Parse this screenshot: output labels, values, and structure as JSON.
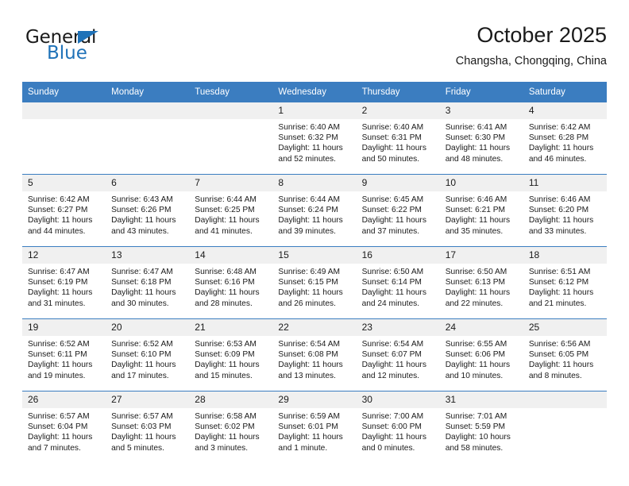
{
  "brand": {
    "name_top": "General",
    "name_bottom": "Blue",
    "accent_color": "#1f72b8",
    "triangle_icon": "triangle-icon"
  },
  "header": {
    "title": "October 2025",
    "subtitle": "Changsha, Chongqing, China"
  },
  "calendar": {
    "header_bg": "#3b7dc0",
    "daynum_bg": "#f0f0f0",
    "weekday_headers": [
      "Sunday",
      "Monday",
      "Tuesday",
      "Wednesday",
      "Thursday",
      "Friday",
      "Saturday"
    ],
    "labels": {
      "sunrise": "Sunrise:",
      "sunset": "Sunset:",
      "daylight": "Daylight:"
    },
    "weeks": [
      [
        {
          "day": "",
          "empty": true
        },
        {
          "day": "",
          "empty": true
        },
        {
          "day": "",
          "empty": true
        },
        {
          "day": "1",
          "sunrise": "Sunrise: 6:40 AM",
          "sunset": "Sunset: 6:32 PM",
          "daylight": "Daylight: 11 hours and 52 minutes."
        },
        {
          "day": "2",
          "sunrise": "Sunrise: 6:40 AM",
          "sunset": "Sunset: 6:31 PM",
          "daylight": "Daylight: 11 hours and 50 minutes."
        },
        {
          "day": "3",
          "sunrise": "Sunrise: 6:41 AM",
          "sunset": "Sunset: 6:30 PM",
          "daylight": "Daylight: 11 hours and 48 minutes."
        },
        {
          "day": "4",
          "sunrise": "Sunrise: 6:42 AM",
          "sunset": "Sunset: 6:28 PM",
          "daylight": "Daylight: 11 hours and 46 minutes."
        }
      ],
      [
        {
          "day": "5",
          "sunrise": "Sunrise: 6:42 AM",
          "sunset": "Sunset: 6:27 PM",
          "daylight": "Daylight: 11 hours and 44 minutes."
        },
        {
          "day": "6",
          "sunrise": "Sunrise: 6:43 AM",
          "sunset": "Sunset: 6:26 PM",
          "daylight": "Daylight: 11 hours and 43 minutes."
        },
        {
          "day": "7",
          "sunrise": "Sunrise: 6:44 AM",
          "sunset": "Sunset: 6:25 PM",
          "daylight": "Daylight: 11 hours and 41 minutes."
        },
        {
          "day": "8",
          "sunrise": "Sunrise: 6:44 AM",
          "sunset": "Sunset: 6:24 PM",
          "daylight": "Daylight: 11 hours and 39 minutes."
        },
        {
          "day": "9",
          "sunrise": "Sunrise: 6:45 AM",
          "sunset": "Sunset: 6:22 PM",
          "daylight": "Daylight: 11 hours and 37 minutes."
        },
        {
          "day": "10",
          "sunrise": "Sunrise: 6:46 AM",
          "sunset": "Sunset: 6:21 PM",
          "daylight": "Daylight: 11 hours and 35 minutes."
        },
        {
          "day": "11",
          "sunrise": "Sunrise: 6:46 AM",
          "sunset": "Sunset: 6:20 PM",
          "daylight": "Daylight: 11 hours and 33 minutes."
        }
      ],
      [
        {
          "day": "12",
          "sunrise": "Sunrise: 6:47 AM",
          "sunset": "Sunset: 6:19 PM",
          "daylight": "Daylight: 11 hours and 31 minutes."
        },
        {
          "day": "13",
          "sunrise": "Sunrise: 6:47 AM",
          "sunset": "Sunset: 6:18 PM",
          "daylight": "Daylight: 11 hours and 30 minutes."
        },
        {
          "day": "14",
          "sunrise": "Sunrise: 6:48 AM",
          "sunset": "Sunset: 6:16 PM",
          "daylight": "Daylight: 11 hours and 28 minutes."
        },
        {
          "day": "15",
          "sunrise": "Sunrise: 6:49 AM",
          "sunset": "Sunset: 6:15 PM",
          "daylight": "Daylight: 11 hours and 26 minutes."
        },
        {
          "day": "16",
          "sunrise": "Sunrise: 6:50 AM",
          "sunset": "Sunset: 6:14 PM",
          "daylight": "Daylight: 11 hours and 24 minutes."
        },
        {
          "day": "17",
          "sunrise": "Sunrise: 6:50 AM",
          "sunset": "Sunset: 6:13 PM",
          "daylight": "Daylight: 11 hours and 22 minutes."
        },
        {
          "day": "18",
          "sunrise": "Sunrise: 6:51 AM",
          "sunset": "Sunset: 6:12 PM",
          "daylight": "Daylight: 11 hours and 21 minutes."
        }
      ],
      [
        {
          "day": "19",
          "sunrise": "Sunrise: 6:52 AM",
          "sunset": "Sunset: 6:11 PM",
          "daylight": "Daylight: 11 hours and 19 minutes."
        },
        {
          "day": "20",
          "sunrise": "Sunrise: 6:52 AM",
          "sunset": "Sunset: 6:10 PM",
          "daylight": "Daylight: 11 hours and 17 minutes."
        },
        {
          "day": "21",
          "sunrise": "Sunrise: 6:53 AM",
          "sunset": "Sunset: 6:09 PM",
          "daylight": "Daylight: 11 hours and 15 minutes."
        },
        {
          "day": "22",
          "sunrise": "Sunrise: 6:54 AM",
          "sunset": "Sunset: 6:08 PM",
          "daylight": "Daylight: 11 hours and 13 minutes."
        },
        {
          "day": "23",
          "sunrise": "Sunrise: 6:54 AM",
          "sunset": "Sunset: 6:07 PM",
          "daylight": "Daylight: 11 hours and 12 minutes."
        },
        {
          "day": "24",
          "sunrise": "Sunrise: 6:55 AM",
          "sunset": "Sunset: 6:06 PM",
          "daylight": "Daylight: 11 hours and 10 minutes."
        },
        {
          "day": "25",
          "sunrise": "Sunrise: 6:56 AM",
          "sunset": "Sunset: 6:05 PM",
          "daylight": "Daylight: 11 hours and 8 minutes."
        }
      ],
      [
        {
          "day": "26",
          "sunrise": "Sunrise: 6:57 AM",
          "sunset": "Sunset: 6:04 PM",
          "daylight": "Daylight: 11 hours and 7 minutes."
        },
        {
          "day": "27",
          "sunrise": "Sunrise: 6:57 AM",
          "sunset": "Sunset: 6:03 PM",
          "daylight": "Daylight: 11 hours and 5 minutes."
        },
        {
          "day": "28",
          "sunrise": "Sunrise: 6:58 AM",
          "sunset": "Sunset: 6:02 PM",
          "daylight": "Daylight: 11 hours and 3 minutes."
        },
        {
          "day": "29",
          "sunrise": "Sunrise: 6:59 AM",
          "sunset": "Sunset: 6:01 PM",
          "daylight": "Daylight: 11 hours and 1 minute."
        },
        {
          "day": "30",
          "sunrise": "Sunrise: 7:00 AM",
          "sunset": "Sunset: 6:00 PM",
          "daylight": "Daylight: 11 hours and 0 minutes."
        },
        {
          "day": "31",
          "sunrise": "Sunrise: 7:01 AM",
          "sunset": "Sunset: 5:59 PM",
          "daylight": "Daylight: 10 hours and 58 minutes."
        },
        {
          "day": "",
          "empty": true
        }
      ]
    ]
  }
}
